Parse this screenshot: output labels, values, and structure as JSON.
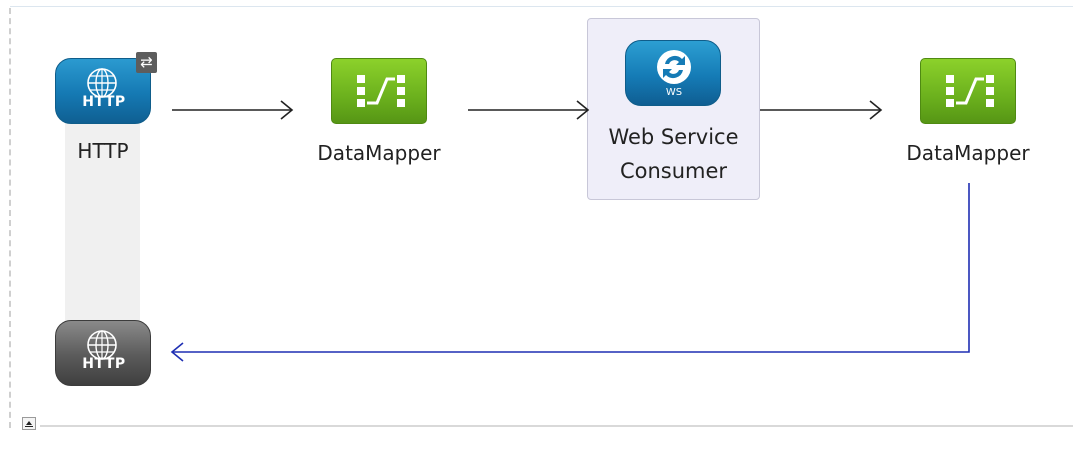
{
  "flow": {
    "nodes": {
      "http_source": {
        "label": "HTTP",
        "icon_text": "HTTP",
        "badge": "⇄"
      },
      "datamapper_1": {
        "label": "DataMapper"
      },
      "ws_consumer": {
        "label_line1": "Web Service",
        "label_line2": "Consumer",
        "icon_text": "WS"
      },
      "datamapper_2": {
        "label": "DataMapper"
      },
      "http_response": {
        "icon_text": "HTTP"
      }
    }
  },
  "colors": {
    "http_blue": "#1579b3",
    "datamapper_green": "#6bb01d",
    "response_gray": "#5a5a5a",
    "return_line": "#1f2fb3",
    "arrow": "#222222",
    "ws_container": "#efeef9"
  },
  "icons": [
    "globe-icon",
    "exchange-pattern-icon",
    "datamapper-icon",
    "web-service-icon",
    "collapse-toggle-icon"
  ]
}
